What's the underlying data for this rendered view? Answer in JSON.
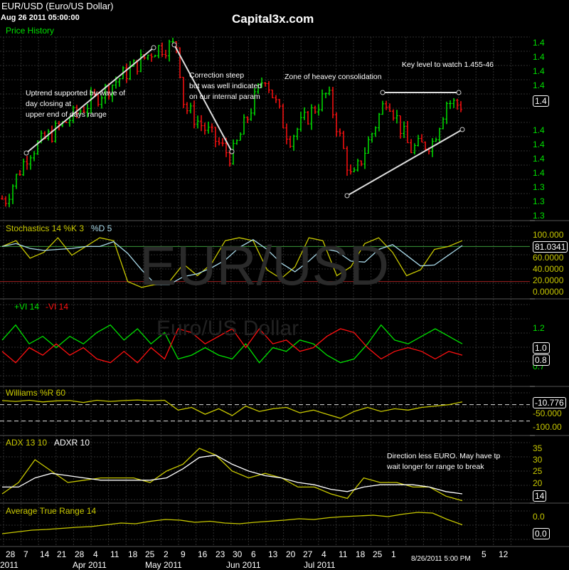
{
  "header": {
    "title": "EUR/USD (Euro/US Dollar)",
    "timestamp": "Aug 26 2011 05:00:00",
    "brand": "Capital3x.com"
  },
  "watermark": {
    "symbol": "EUR/USD",
    "name": "Euro/US Dollar"
  },
  "colors": {
    "up": "#00e000",
    "down": "#ff1010",
    "yellow": "#c8c800",
    "white": "#ffffff",
    "lightblue": "#a8d8e8",
    "grid": "#2e2e2e"
  },
  "panels": {
    "price": {
      "label": "Price History",
      "ticks": [
        "1.4",
        "1.4",
        "1.4",
        "1.4",
        "1.4",
        "1.4",
        "1.4",
        "1.4",
        "1.3",
        "1.3",
        "1.3"
      ],
      "current": "1.4"
    },
    "stoch": {
      "label_a": "Stochastics 14 %K 3",
      "label_b": "%D 5",
      "ticks": [
        "100.000",
        "60.0000",
        "40.0000",
        "20.0000",
        "0.00000"
      ],
      "current": "81.0341"
    },
    "vi": {
      "label_a": "+VI 14",
      "label_b": "-VI 14",
      "ticks": [
        "1.2",
        "0.7"
      ],
      "current_plus": "1.0",
      "current_minus": "0.8"
    },
    "williams": {
      "label": "Williams %R 60",
      "ticks": [
        "-50.000",
        "-100.00"
      ],
      "current": "-10.776"
    },
    "adx": {
      "label_a": "ADX 13 10",
      "label_b": "ADXR 10",
      "ticks": [
        "35",
        "30",
        "25",
        "20"
      ],
      "current": "14"
    },
    "atr": {
      "label": "Average True Range 14",
      "ticks": [
        "0.0"
      ],
      "current": "0.0"
    }
  },
  "annotations": {
    "uptrend": [
      "Uptrend supported by wave of",
      "day closing at",
      "upper end of days range"
    ],
    "correction": [
      "Correction steep",
      "but was well indicated",
      "on our internal param"
    ],
    "zone": "Zone of heavey consolidation",
    "key_level": "Key level to watch 1.455-46",
    "direction": [
      "Direction less EURO. May have tp",
      "wait longer for range to break"
    ]
  },
  "xaxis": {
    "days": [
      "28",
      "7",
      "14",
      "21",
      "28",
      "4",
      "11",
      "18",
      "25",
      "2",
      "9",
      "16",
      "23",
      "30",
      "6",
      "13",
      "20",
      "27",
      "4",
      "11",
      "18",
      "25",
      "1",
      "5",
      "12"
    ],
    "months": [
      "Mar 2011",
      "Apr 2011",
      "May 2011",
      "Jun 2011",
      "Jul 2011"
    ],
    "cursor_time": "8/26/2011 5:00 PM"
  },
  "chart_data": [
    {
      "type": "candlestick",
      "title": "Price History",
      "ylim": [
        1.365,
        1.49
      ],
      "price_path_week_index": [
        0,
        1.3,
        8.6,
        9.8,
        10.2,
        12.9,
        14.8,
        16.2,
        18.4,
        19.8,
        21.8,
        23.1,
        24.4,
        25.2,
        26.4
      ],
      "price_path_close": [
        1.378,
        1.408,
        1.476,
        1.478,
        1.438,
        1.405,
        1.459,
        1.417,
        1.447,
        1.389,
        1.445,
        1.41,
        1.415,
        1.441,
        1.438
      ]
    },
    {
      "type": "line",
      "title": "Stochastics 14 %K 3 %D 5",
      "ylim": [
        0,
        100
      ],
      "levels": [
        80,
        20
      ],
      "series": [
        {
          "name": "%K",
          "values": [
            80,
            90,
            60,
            70,
            95,
            65,
            80,
            95,
            90,
            20,
            10,
            15,
            20,
            50,
            30,
            50,
            90,
            95,
            90,
            40,
            25,
            45,
            95,
            90,
            30,
            45,
            85,
            95,
            70,
            30,
            40,
            75,
            80,
            90
          ]
        }
      ]
    },
    {
      "type": "line",
      "title": "Vortex",
      "ylim": [
        0.65,
        1.3
      ],
      "series": [
        {
          "name": "+VI 14",
          "values": [
            1.05,
            1.25,
            1.0,
            1.1,
            0.95,
            1.1,
            1.0,
            1.15,
            1.25,
            1.05,
            1.2,
            1.0,
            1.15,
            0.8,
            0.85,
            0.95,
            0.85,
            0.8,
            1.0,
            0.75,
            0.95,
            0.9,
            1.05,
            1.0,
            0.85,
            0.75,
            0.8,
            1.0,
            1.25,
            1.05,
            1.0,
            1.1,
            1.2,
            1.1,
            1.0
          ]
        },
        {
          "name": "-VI 14",
          "values": [
            0.9,
            0.75,
            0.95,
            0.85,
            1.0,
            0.85,
            0.95,
            0.8,
            0.75,
            0.9,
            0.75,
            0.95,
            0.8,
            1.2,
            1.15,
            1.0,
            1.1,
            1.2,
            0.95,
            1.2,
            1.0,
            1.05,
            0.9,
            0.95,
            1.1,
            1.2,
            1.15,
            0.95,
            0.8,
            0.9,
            0.95,
            0.9,
            0.8,
            0.9,
            0.85
          ]
        }
      ]
    },
    {
      "type": "line",
      "title": "Williams %R 60",
      "ylim": [
        -100,
        0
      ],
      "levels": [
        -20,
        -80
      ],
      "series": [
        {
          "name": "%R",
          "values": [
            -5,
            -8,
            -4,
            -10,
            -6,
            -5,
            -12,
            -4,
            -8,
            -5,
            -3,
            -6,
            -4,
            -40,
            -30,
            -55,
            -35,
            -60,
            -25,
            -45,
            -35,
            -30,
            -50,
            -40,
            -55,
            -70,
            -45,
            -30,
            -45,
            -35,
            -40,
            -30,
            -25,
            -20,
            -10
          ]
        }
      ]
    },
    {
      "type": "line",
      "title": "ADX 13 10 ADXR 10",
      "ylim": [
        10,
        38
      ],
      "series": [
        {
          "name": "ADX",
          "values": [
            15,
            20,
            30,
            25,
            20,
            21,
            22,
            22,
            22,
            20,
            25,
            28,
            35,
            32,
            25,
            22,
            24,
            22,
            18,
            18,
            15,
            13,
            22,
            20,
            20,
            18,
            18,
            14,
            12
          ]
        },
        {
          "name": "ADXR",
          "values": [
            18,
            18,
            22,
            24,
            23,
            22,
            21,
            21,
            21,
            21,
            22,
            26,
            31,
            32,
            28,
            25,
            23,
            22,
            20,
            19,
            17,
            16,
            18,
            19,
            19,
            19,
            18,
            16,
            15
          ]
        }
      ]
    },
    {
      "type": "line",
      "title": "Average True Range 14",
      "ylim": [
        0.008,
        0.018
      ],
      "series": [
        {
          "name": "ATR",
          "values": [
            0.01,
            0.0105,
            0.011,
            0.0112,
            0.0115,
            0.0118,
            0.012,
            0.0125,
            0.013,
            0.0128,
            0.0135,
            0.014,
            0.0138,
            0.0132,
            0.0135,
            0.013,
            0.0128,
            0.0132,
            0.0135,
            0.0138,
            0.0142,
            0.014,
            0.0145,
            0.0148,
            0.015,
            0.0152,
            0.0148,
            0.0155,
            0.016,
            0.0158,
            0.014,
            0.0125
          ]
        }
      ]
    }
  ]
}
